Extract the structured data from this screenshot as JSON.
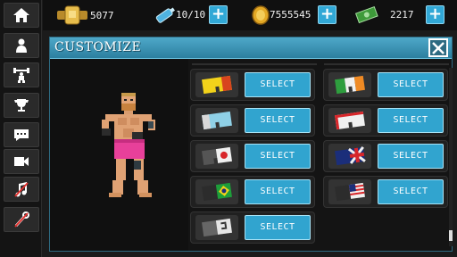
{
  "sidebar": {
    "items": [
      {
        "name": "home",
        "icon": "home-icon"
      },
      {
        "name": "profile",
        "icon": "person-icon"
      },
      {
        "name": "training",
        "icon": "weightlifter-icon"
      },
      {
        "name": "trophies",
        "icon": "trophy-icon"
      },
      {
        "name": "messages",
        "icon": "chat-icon"
      },
      {
        "name": "video",
        "icon": "camera-icon"
      },
      {
        "name": "music",
        "icon": "music-icon"
      },
      {
        "name": "settings",
        "icon": "wrench-icon"
      }
    ]
  },
  "topbar": {
    "belts": "5077",
    "energy": "10/10",
    "coins": "7555545",
    "cash": "2217"
  },
  "panel": {
    "title": "CUSTOMIZE"
  },
  "shorts": [
    {
      "design": "yellow-red",
      "colors": [
        "#f2d21a",
        "#d8451e"
      ],
      "button": "SELECT"
    },
    {
      "design": "irish",
      "colors": [
        "#2e9e3e",
        "#f0f0f0",
        "#ef8a24"
      ],
      "button": "SELECT"
    },
    {
      "design": "light-blue",
      "colors": [
        "#8fd0e6",
        "#d8d8d8"
      ],
      "button": "SELECT"
    },
    {
      "design": "white-red",
      "colors": [
        "#f0f0f0",
        "#d8262a"
      ],
      "button": "SELECT"
    },
    {
      "design": "japan",
      "colors": [
        "#555555",
        "#f0f0f0",
        "#d8262a"
      ],
      "button": "SELECT"
    },
    {
      "design": "uk",
      "colors": [
        "#1b2e7a",
        "#f0f0f0",
        "#d8262a"
      ],
      "button": "SELECT"
    },
    {
      "design": "brazil",
      "colors": [
        "#2c2c2c",
        "#1e9e3a",
        "#f2d21a"
      ],
      "button": "SELECT"
    },
    {
      "design": "usa",
      "colors": [
        "#2c2c2c",
        "#1b2e7a",
        "#d8262a"
      ],
      "button": "SELECT"
    },
    {
      "design": "grey-number",
      "colors": [
        "#666666",
        "#e6e6e6"
      ],
      "button": "SELECT"
    }
  ],
  "colors": {
    "accent": "#31a4cf",
    "header": "#3c93b5"
  }
}
